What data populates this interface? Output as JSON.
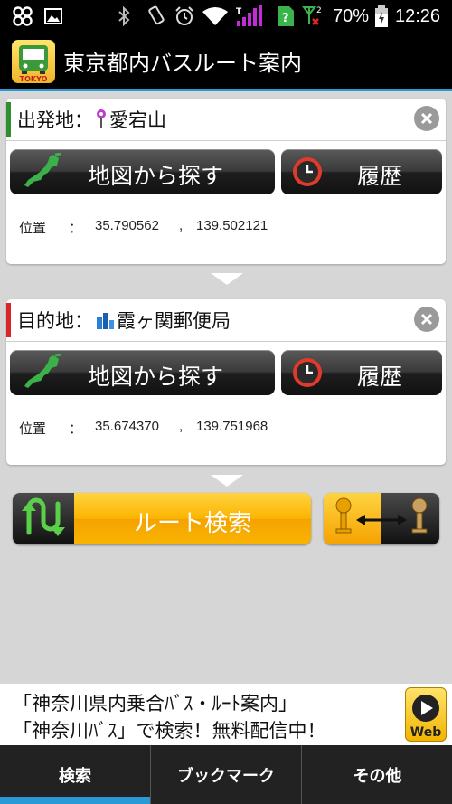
{
  "status_bar": {
    "battery": "70%",
    "time": "12:26"
  },
  "app": {
    "title": "東京都内バスルート案内",
    "icon_badge": "TOKYO"
  },
  "departure": {
    "label": "出発地：",
    "name": "愛宕山",
    "map_button": "地図から探す",
    "history_button": "履歴",
    "coord_label": "位置",
    "sep": "：",
    "lat": "35.790562",
    "comma": ",",
    "lon": "139.502121",
    "accent": "#2f8f2f"
  },
  "destination": {
    "label": "目的地：",
    "name": "霞ヶ関郵便局",
    "map_button": "地図から探す",
    "history_button": "履歴",
    "coord_label": "位置",
    "sep": "：",
    "lat": "35.674370",
    "comma": ",",
    "lon": "139.751968",
    "accent": "#d8262a"
  },
  "route_search": {
    "label": "ルート検索"
  },
  "ad": {
    "line1": "「神奈川県内乗合ﾊﾞｽ・ﾙｰﾄ案内」",
    "line2": "「神奈川ﾊﾞｽ」で検索！無料配信中！",
    "badge": "Web"
  },
  "tabs": [
    {
      "label": "検索",
      "active": true
    },
    {
      "label": "ブックマーク",
      "active": false
    },
    {
      "label": "その他",
      "active": false
    }
  ],
  "colors": {
    "accent_blue": "#2a9ad6",
    "orange": "#f9b400"
  }
}
